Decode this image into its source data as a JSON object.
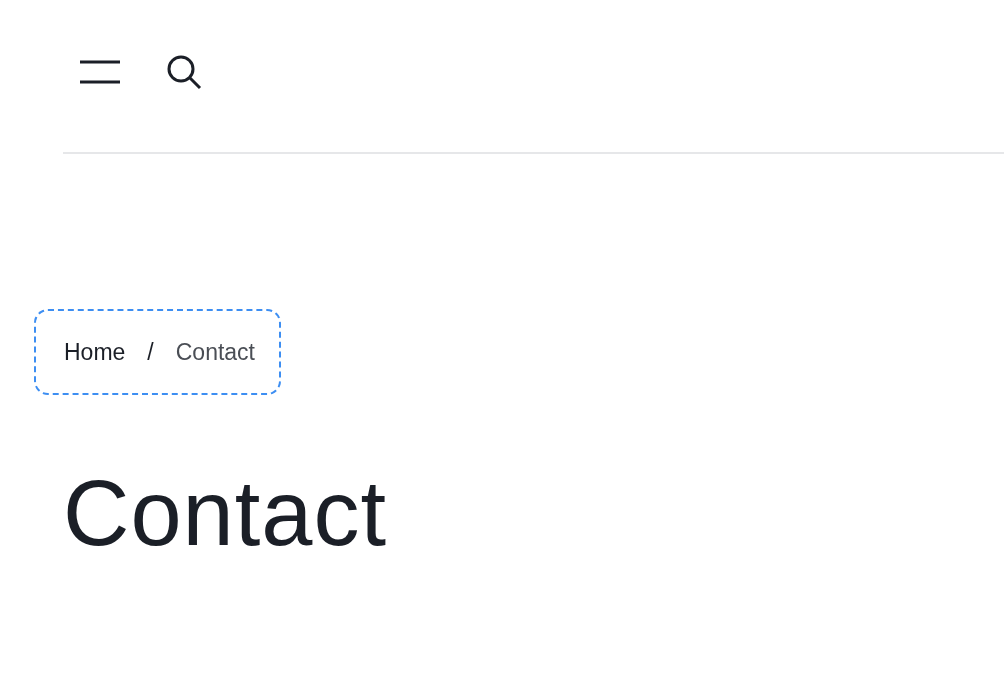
{
  "breadcrumb": {
    "focused": true,
    "separator": "/",
    "items": [
      {
        "label": "Home",
        "current": false
      },
      {
        "label": "Contact",
        "current": true
      }
    ]
  },
  "heading": "Contact"
}
